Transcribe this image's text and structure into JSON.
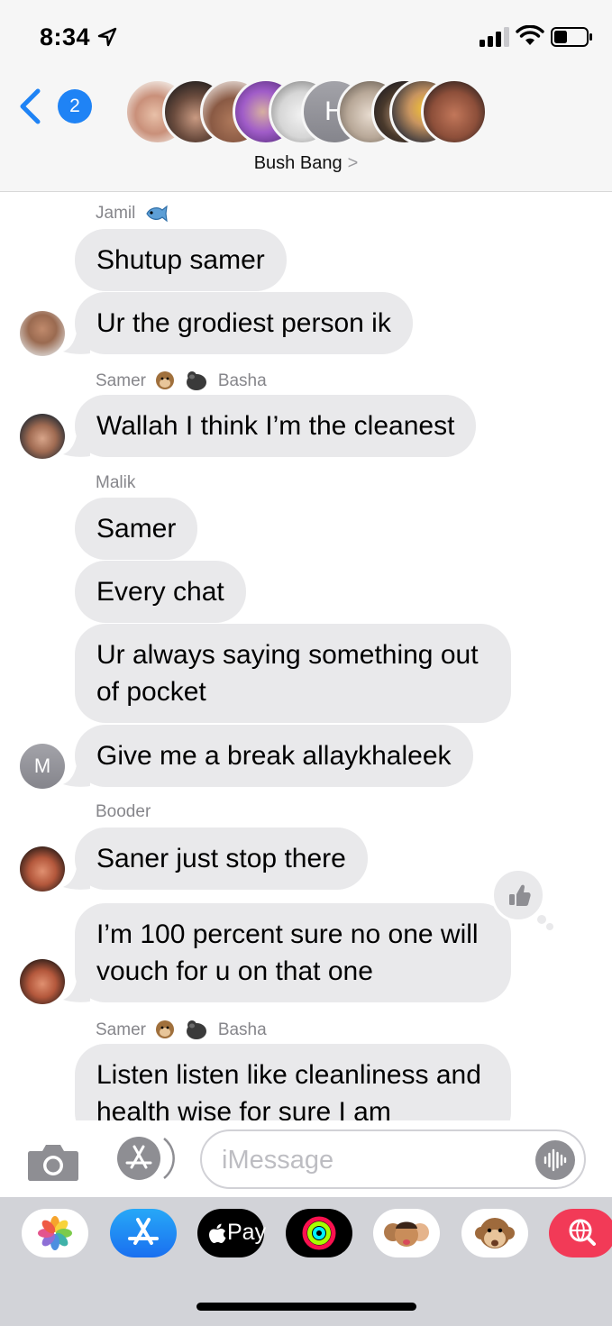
{
  "status_bar": {
    "time": "8:34"
  },
  "header": {
    "back_badge": "2",
    "group_name": "Bush Bang",
    "group_chevron": ">",
    "initial_letter": "H"
  },
  "messages": [
    {
      "sender": "Jamil",
      "sender_emoji": "fish-emoji",
      "text": "Shutup samer"
    },
    {
      "text": "Ur the grodiest person ik"
    },
    {
      "sender": "Samer",
      "sender_suffix": "Basha",
      "sender_emoji": "monkey-gorilla-emoji",
      "text": "Wallah I think I’m the cleanest"
    },
    {
      "sender": "Malik",
      "text": "Samer"
    },
    {
      "text": "Every chat"
    },
    {
      "text": "Ur always saying something out of pocket"
    },
    {
      "text": "Give me a break allaykhaleek",
      "avatar_initial": "M"
    },
    {
      "sender": "Booder",
      "text": "Saner just stop there"
    },
    {
      "text": "I’m 100 percent sure no one will vouch for u on that one",
      "tapback": "thumbs-up-icon"
    },
    {
      "sender": "Samer",
      "sender_suffix": "Basha",
      "sender_emoji": "monkey-gorilla-emoji",
      "text": "Listen listen like cleanliness and health wise for sure I am"
    }
  ],
  "input": {
    "placeholder": "iMessage"
  },
  "drawer": {
    "apps": [
      "photos-icon",
      "app-store-icon",
      "apple-pay-icon",
      "activity-icon",
      "memoji-icon",
      "animoji-icon",
      "web-search-icon"
    ],
    "apple_pay_label": "Pay"
  }
}
